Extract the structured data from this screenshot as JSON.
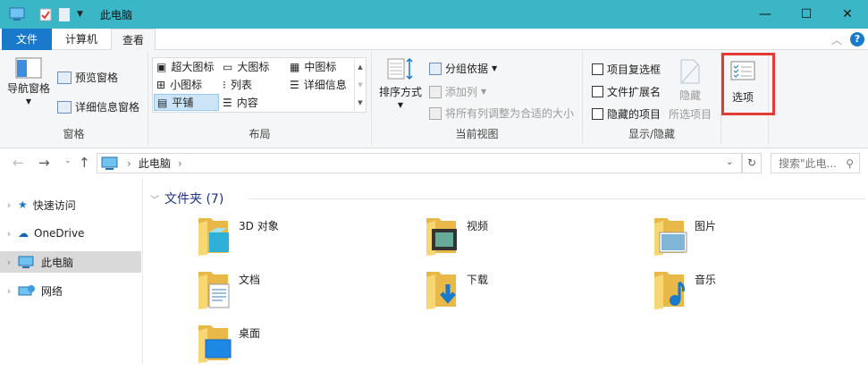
{
  "window": {
    "title": "此电脑",
    "minimize": "—",
    "maximize": "☐",
    "close": "✕"
  },
  "tabs": {
    "file": "文件",
    "computer": "计算机",
    "view": "查看"
  },
  "ribbon": {
    "panes": {
      "nav_pane": "导航窗格",
      "preview_pane": "预览窗格",
      "details_pane": "详细信息窗格",
      "label": "窗格"
    },
    "layout": {
      "items": [
        "超大图标",
        "大图标",
        "中图标",
        "小图标",
        "列表",
        "详细信息",
        "平铺",
        "内容"
      ],
      "selected": "平铺",
      "label": "布局"
    },
    "current_view": {
      "sort_by": "排序方式",
      "group_by": "分组依据",
      "add_column": "添加列",
      "size_all": "将所有列调整为合适的大小",
      "label": "当前视图"
    },
    "show_hide": {
      "item_checkboxes": "项目复选框",
      "file_extensions": "文件扩展名",
      "hidden_items": "隐藏的项目",
      "hide_selected_1": "隐藏",
      "hide_selected_2": "所选项目",
      "label": "显示/隐藏"
    },
    "options": {
      "label": "选项"
    }
  },
  "address": {
    "path": "此电脑",
    "search_placeholder": "搜索\"此电..."
  },
  "sidebar": {
    "items": [
      {
        "label": "快速访问"
      },
      {
        "label": "OneDrive"
      },
      {
        "label": "此电脑"
      },
      {
        "label": "网络"
      }
    ]
  },
  "main": {
    "section": "文件夹 (7)",
    "folders": [
      "3D 对象",
      "视频",
      "图片",
      "文档",
      "下载",
      "音乐",
      "桌面"
    ]
  },
  "colors": {
    "titlebar": "#3bb6c6",
    "file_tab": "#1979ca",
    "highlight": "#e53935",
    "section": "#1e3287"
  }
}
